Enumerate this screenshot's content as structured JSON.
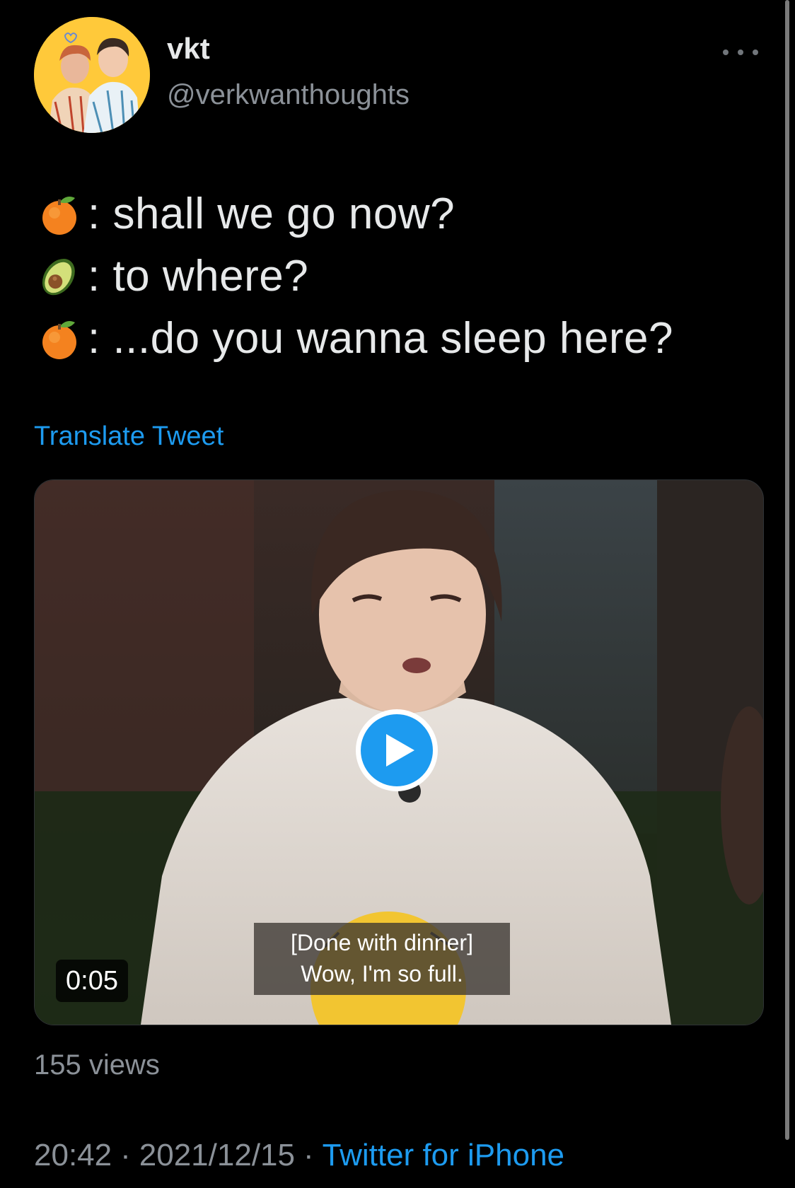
{
  "user": {
    "display_name": "vkt",
    "handle": "@verkwanthoughts",
    "avatar_icon": "profile-photo"
  },
  "tweet": {
    "lines": [
      {
        "emoji": "tangerine",
        "text": ": shall we go now?"
      },
      {
        "emoji": "avocado",
        "text": ": to where?"
      },
      {
        "emoji": "tangerine",
        "text": ": ...do you wanna sleep here?"
      }
    ],
    "translate_label": "Translate Tweet"
  },
  "media": {
    "subtitle_line1": "[Done with dinner]",
    "subtitle_line2": "Wow, I'm so full.",
    "duration": "0:05",
    "play_icon": "play-icon"
  },
  "footer": {
    "views": "155 views",
    "time": "20:42",
    "date": "2021/12/15",
    "separator": "·",
    "source": "Twitter for iPhone"
  },
  "colors": {
    "background": "#000000",
    "accent": "#1d9bf0",
    "secondary_text": "#8b9198"
  }
}
